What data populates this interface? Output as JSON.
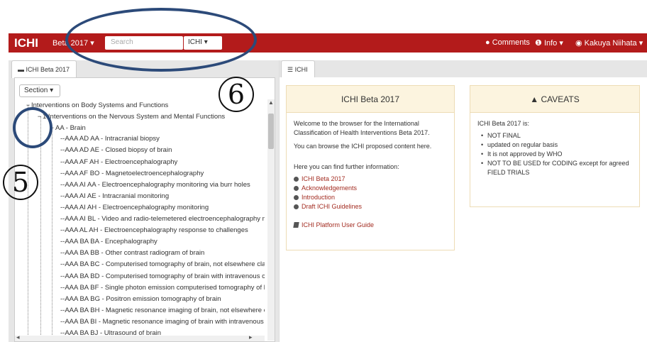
{
  "navbar": {
    "brand": "ICHI",
    "version_dropdown": "Beta 2017",
    "search_placeholder": "Search",
    "search_scope": "ICHI",
    "comments": "Comments",
    "info": "Info",
    "user": "Kakuya Niihata",
    "background_color": "#b31b1b"
  },
  "left_panel": {
    "tab_label": "ICHI Beta 2017",
    "section_button": "Section",
    "tree": [
      {
        "label": "Interventions on Body Systems and Functions",
        "twisty": "−"
      },
      {
        "label": "1 Interventions on the Nervous System and Mental Functions",
        "twisty": "−"
      },
      {
        "label": "AA - Brain",
        "twisty": "−"
      },
      {
        "label": "AAA AD AA - Intracranial biopsy"
      },
      {
        "label": "AAA AD AE - Closed biopsy of brain"
      },
      {
        "label": "AAA AF AH - Electroencephalography"
      },
      {
        "label": "AAA AF BO - Magnetoelectroencephalography"
      },
      {
        "label": "AAA AI AA - Electroencephalography monitoring via burr holes"
      },
      {
        "label": "AAA AI AE - Intracranial monitoring"
      },
      {
        "label": "AAA AI AH - Electroencephalography monitoring"
      },
      {
        "label": "AAA AI BL - Video and radio-telemetered electroencephalography m"
      },
      {
        "label": "AAA AL AH - Electroencephalography response to challenges"
      },
      {
        "label": "AAA BA BA - Encephalography"
      },
      {
        "label": "AAA BA BB - Other contrast radiogram of brain"
      },
      {
        "label": "AAA BA BC - Computerised tomography of brain, not elsewhere clas"
      },
      {
        "label": "AAA BA BD - Computerised tomography of brain with intravenous cc"
      },
      {
        "label": "AAA BA BF - Single photon emission computerised tomography of b"
      },
      {
        "label": "AAA BA BG - Positron emission tomography of brain"
      },
      {
        "label": "AAA BA BH - Magnetic resonance imaging of brain, not elsewhere c"
      },
      {
        "label": "AAA BA BI - Magnetic resonance imaging of brain with intravenous c"
      },
      {
        "label": "AAA BA BJ - Ultrasound of brain"
      }
    ]
  },
  "right_panel": {
    "tab_label": "ICHI",
    "main_card": {
      "title": "ICHI Beta 2017",
      "welcome": "Welcome to the browser for the International Classification of Health Interventions Beta 2017.",
      "browse": "You can browse the ICHI proposed content here.",
      "further": "Here you can find further information:",
      "links": [
        "ICHI Beta 2017",
        "Acknowledgements",
        "Introduction",
        "Draft ICHI Guidelines"
      ],
      "guide": "ICHI Platform User Guide"
    },
    "caveats_card": {
      "title": "CAVEATS",
      "intro": "ICHI Beta 2017 is:",
      "items": [
        "NOT FINAL",
        "updated on regular basis",
        "It is not approved by WHO",
        "NOT TO BE USED for CODING except for agreed FIELD TRIALS"
      ]
    }
  },
  "annotations": {
    "label_5": "5",
    "label_6": "6",
    "ellipse_color": "#2c4a79"
  }
}
